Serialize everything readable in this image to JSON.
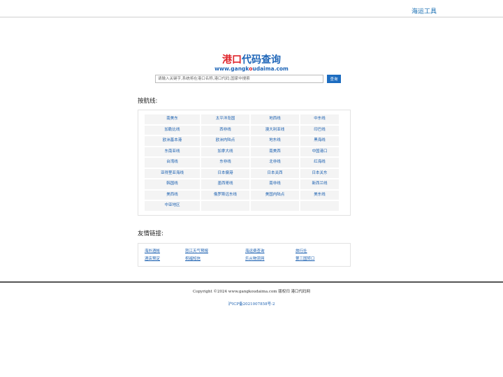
{
  "header": {
    "top_link": "海运工具"
  },
  "logo": {
    "title_part1": "港口",
    "title_part2": "代码查询",
    "url_pre": "www.gangk",
    "url_o": "o",
    "url_post": "udaima.com"
  },
  "search": {
    "placeholder": "请输入关键字,系统将在港口名称,港口代码,国家中搜索",
    "button": "查询"
  },
  "routes": {
    "title": "按航线:",
    "items": [
      "南美东",
      "太平洋岛国",
      "地西线",
      "中东线",
      "加勒比线",
      "西非线",
      "澳大利亚线",
      "印巴线",
      "欧洲基本港",
      "欧洲内陆点",
      "地东线",
      "黑海线",
      "东南亚线",
      "加拿大线",
      "南美西",
      "中国港口",
      "台湾线",
      "东非线",
      "北非线",
      "红海线",
      "亚得里亚海线",
      "日本偏港",
      "日本关西",
      "日本关东",
      "韩国线",
      "墨西哥线",
      "南非线",
      "新西兰线",
      "美西线",
      "俄罗斯远东线",
      "美国内陆点",
      "美东线",
      "中亚地区",
      "",
      "",
      ""
    ]
  },
  "friends": {
    "title": "友情链接:",
    "links": [
      "海外酒帐",
      "怒江天气预报",
      "海运费查询",
      "旅行社",
      "酒店预定",
      "祝福短信",
      "乐从物流网",
      "第三国转口"
    ]
  },
  "footer": {
    "copyright": "Copyright ©2024 www.gangkoudaima.com 版权归 港口代码网",
    "icp": "沪ICP备2021007858号-2"
  }
}
